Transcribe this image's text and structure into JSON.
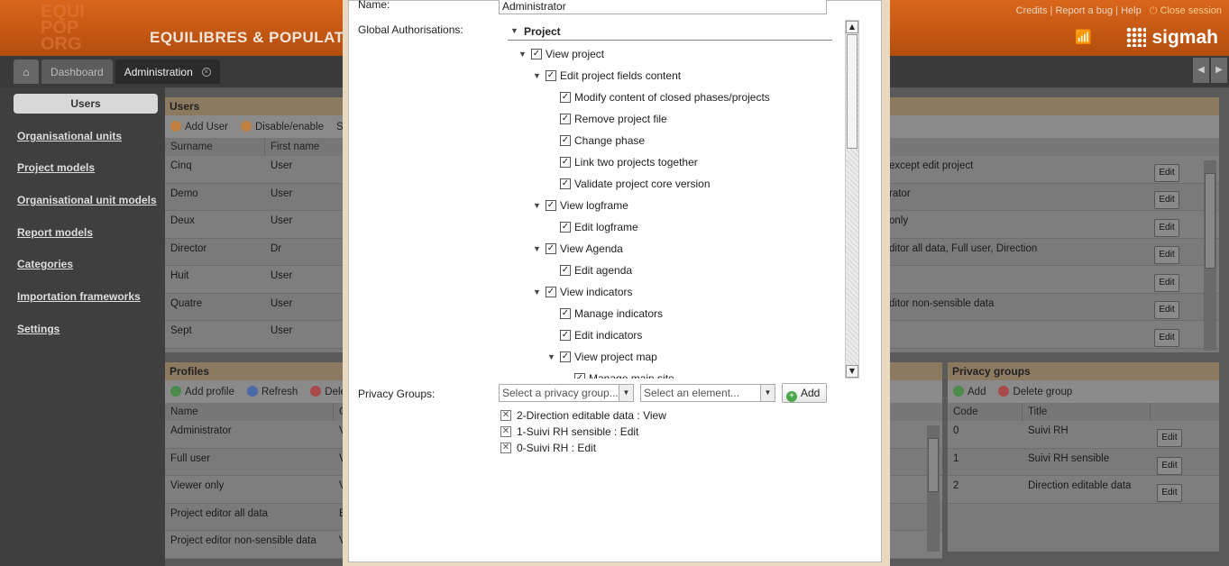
{
  "header": {
    "logo_lines": [
      "EQUI",
      "POP",
      "ORG"
    ],
    "org_title": "EQUILIBRES & POPULATIONS",
    "links": [
      "Credits",
      "Report a bug",
      "Help"
    ],
    "close_session": "Close session",
    "brand": "sigmah"
  },
  "tabs": [
    {
      "label": "Dashboard"
    },
    {
      "label": "Administration"
    }
  ],
  "sidebar": {
    "active": "Users",
    "items": [
      "Organisational units",
      "Project models",
      "Organisational unit models",
      "Report models",
      "Categories",
      "Importation frameworks",
      "Settings"
    ]
  },
  "users_panel": {
    "title": "Users",
    "toolbar": [
      "Add User",
      "Disable/enable",
      "See"
    ],
    "columns": [
      "Surname",
      "First name"
    ],
    "rows": [
      {
        "surname": "Cinq",
        "first": "User",
        "profiles": "except edit project"
      },
      {
        "surname": "Demo",
        "first": "User",
        "profiles": "rator"
      },
      {
        "surname": "Deux",
        "first": "User",
        "profiles": "only"
      },
      {
        "surname": "Director",
        "first": "Dr",
        "profiles": "ditor all data, Full user, Direction"
      },
      {
        "surname": "Huit",
        "first": "User",
        "profiles": ""
      },
      {
        "surname": "Quatre",
        "first": "User",
        "profiles": "ditor non-sensible data"
      },
      {
        "surname": "Sept",
        "first": "User",
        "profiles": ""
      }
    ],
    "edit_label": "Edit"
  },
  "profiles_panel": {
    "title": "Profiles",
    "toolbar": [
      "Add profile",
      "Refresh",
      "Dele"
    ],
    "columns": [
      "Name",
      "G"
    ],
    "rows": [
      {
        "name": "Administrator",
        "g": "V"
      },
      {
        "name": "Full user",
        "g": "V"
      },
      {
        "name": "Viewer only",
        "g": "V"
      },
      {
        "name": "Project editor all data",
        "g": "E"
      },
      {
        "name": "Project editor non-sensible data",
        "g": "V"
      }
    ]
  },
  "privacy_panel": {
    "title": "Privacy groups",
    "toolbar": [
      "Add",
      "Delete group"
    ],
    "columns": [
      "Code",
      "Title"
    ],
    "rows": [
      {
        "code": "0",
        "title": "Suivi RH"
      },
      {
        "code": "1",
        "title": "Suivi RH sensible"
      },
      {
        "code": "2",
        "title": "Direction editable data"
      }
    ],
    "edit_label": "Edit"
  },
  "modal": {
    "name_label": "Name:",
    "name_value": "Administrator",
    "global_auth_label": "Global Authorisations:",
    "tree_root": "Project",
    "tree": [
      {
        "label": "View project",
        "level": 0,
        "expandable": true
      },
      {
        "label": "Edit project fields content",
        "level": 1,
        "expandable": true
      },
      {
        "label": "Modify content of closed phases/projects",
        "level": 2,
        "expandable": false
      },
      {
        "label": "Remove project file",
        "level": 2,
        "expandable": false
      },
      {
        "label": "Change phase",
        "level": 2,
        "expandable": false
      },
      {
        "label": "Link two projects together",
        "level": 2,
        "expandable": false
      },
      {
        "label": "Validate project core version",
        "level": 2,
        "expandable": false
      },
      {
        "label": "View logframe",
        "level": 1,
        "expandable": true
      },
      {
        "label": "Edit logframe",
        "level": 2,
        "expandable": false
      },
      {
        "label": "View Agenda",
        "level": 1,
        "expandable": true
      },
      {
        "label": "Edit agenda",
        "level": 2,
        "expandable": false
      },
      {
        "label": "View indicators",
        "level": 1,
        "expandable": true
      },
      {
        "label": "Manage indicators",
        "level": 2,
        "expandable": false
      },
      {
        "label": "Edit indicators",
        "level": 2,
        "expandable": false
      },
      {
        "label": "View project map",
        "level": 2,
        "expandable": true
      },
      {
        "label": "Manage main site",
        "level": 3,
        "expandable": false
      }
    ],
    "privacy_label": "Privacy Groups:",
    "privacy_select_placeholder": "Select a privacy group...",
    "element_select_placeholder": "Select an element...",
    "add_label": "Add",
    "privacy_items": [
      "2-Direction editable data : View",
      "1-Suivi RH sensible : Edit",
      "0-Suivi RH : Edit"
    ]
  },
  "colors": {
    "header_orange": "#d9661b",
    "panel_head": "#8c7a60",
    "modal_frame": "#e8d9c0"
  }
}
